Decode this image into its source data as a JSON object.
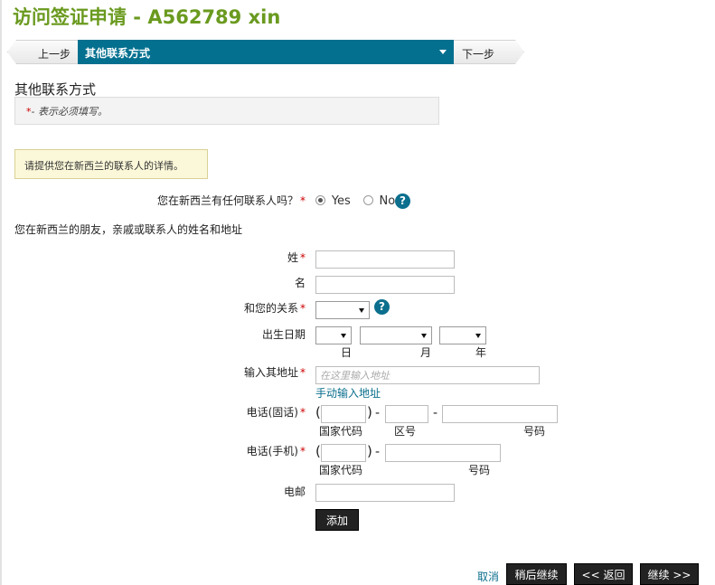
{
  "page": {
    "title": "访问签证申请 - A562789 xin"
  },
  "step_nav": {
    "prev_label": "上一步",
    "current_label": "其他联系方式",
    "next_label": "下一步"
  },
  "section": {
    "heading": "其他联系方式",
    "required_star": "*",
    "required_note": "- 表示必须填写。",
    "info_text": "请提供您在新西兰的联系人的详情。"
  },
  "has_contact": {
    "question": "您在新西兰有任何联系人吗？",
    "options": [
      "Yes",
      "No"
    ],
    "selected": "Yes"
  },
  "contact_intro": "您在新西兰的朋友，亲戚或联系人的姓名和地址",
  "fields": {
    "surname_label": "姓",
    "surname_value": "",
    "given_name_label": "名",
    "given_name_value": "",
    "relationship_label": "和您的关系",
    "relationship_value": "",
    "dob_label": "出生日期",
    "dob_day": "日",
    "dob_month": "月",
    "dob_year": "年",
    "address_label": "输入其地址",
    "address_placeholder": "在这里输入地址",
    "manual_address_link": "手动输入地址",
    "landline_label": "电话(固话)",
    "country_code": "国家代码",
    "area_code": "区号",
    "number": "号码",
    "mobile_label": "电话(手机)",
    "email_label": "电邮",
    "email_value": "",
    "add_button": "添加"
  },
  "footer": {
    "cancel": "取消",
    "save_later": "稍后继续",
    "back": "<< 返回",
    "continue": "继续 >>"
  },
  "colors": {
    "title_green": "#6a9a1f",
    "step_active": "#04708f",
    "required_red": "#cc0000",
    "link_blue": "#0b6f8d",
    "info_box_bg": "#fbf8d9"
  }
}
